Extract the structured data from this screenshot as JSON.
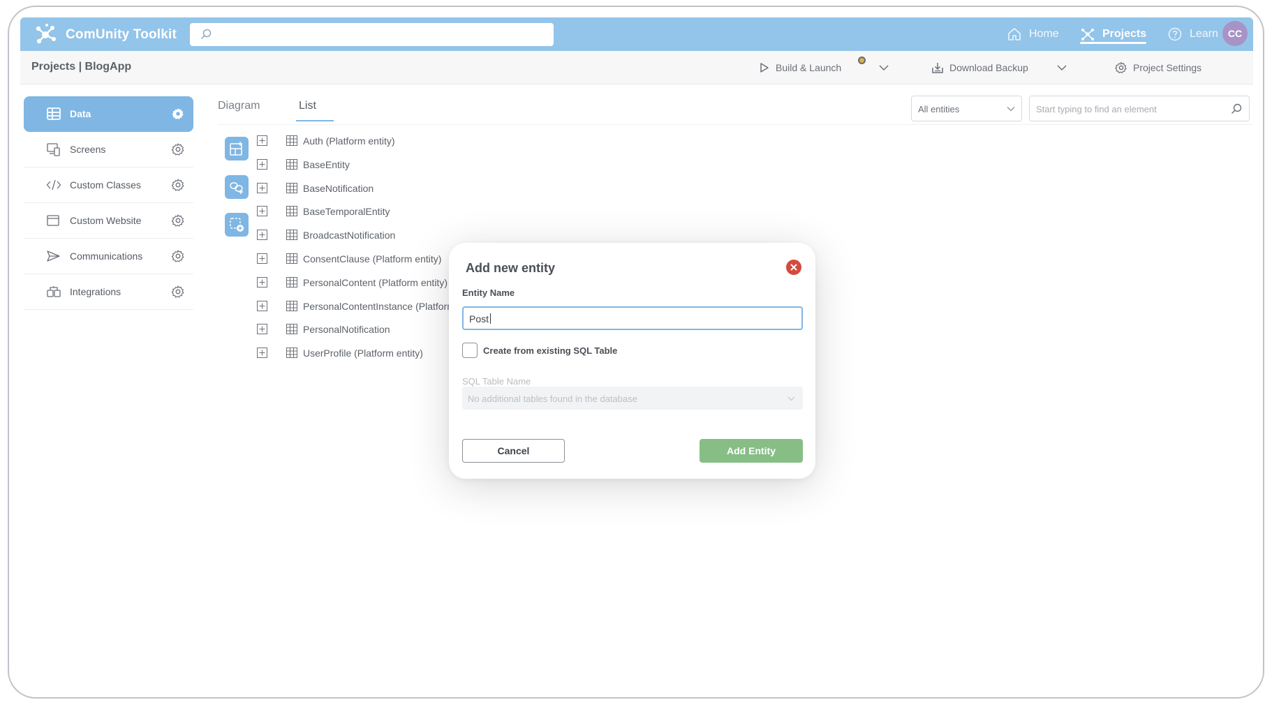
{
  "app": {
    "brand": "ComUnity Toolkit",
    "search_placeholder": "",
    "nav": {
      "home": "Home",
      "projects": "Projects",
      "learn": "Learn"
    },
    "avatar_initials": "CC"
  },
  "subheader": {
    "breadcrumb": "Projects | BlogApp",
    "build_launch": "Build & Launch",
    "download_backup": "Download Backup",
    "project_settings": "Project Settings"
  },
  "sidebar": {
    "items": [
      {
        "label": "Data",
        "icon": "table-icon"
      },
      {
        "label": "Screens",
        "icon": "screens-icon"
      },
      {
        "label": "Custom Classes",
        "icon": "code-icon"
      },
      {
        "label": "Custom Website",
        "icon": "browser-icon"
      },
      {
        "label": "Communications",
        "icon": "send-icon"
      },
      {
        "label": "Integrations",
        "icon": "integrations-icon"
      }
    ]
  },
  "main": {
    "tabs": [
      "Diagram",
      "List"
    ],
    "active_tab": "List",
    "filter_value": "All entities",
    "find_placeholder": "Start typing to find an element",
    "entities": [
      "Auth (Platform entity)",
      "BaseEntity",
      "BaseNotification",
      "BaseTemporalEntity",
      "BroadcastNotification",
      "ConsentClause (Platform entity)",
      "PersonalContent (Platform entity)",
      "PersonalContentInstance (Platform",
      "PersonalNotification",
      "UserProfile (Platform entity)"
    ]
  },
  "modal": {
    "title": "Add new entity",
    "entity_name_label": "Entity Name",
    "entity_name_value": "Post",
    "checkbox_label": "Create from existing SQL Table",
    "checkbox_checked": false,
    "sql_label": "SQL Table Name",
    "sql_placeholder": "No additional tables found in the database",
    "cancel": "Cancel",
    "add": "Add Entity"
  },
  "colors": {
    "topbar": "#93c4e9",
    "accent": "#7fb6e3",
    "add_button": "#86be85",
    "close_button": "#d44a3d",
    "avatar": "#a793c6"
  }
}
